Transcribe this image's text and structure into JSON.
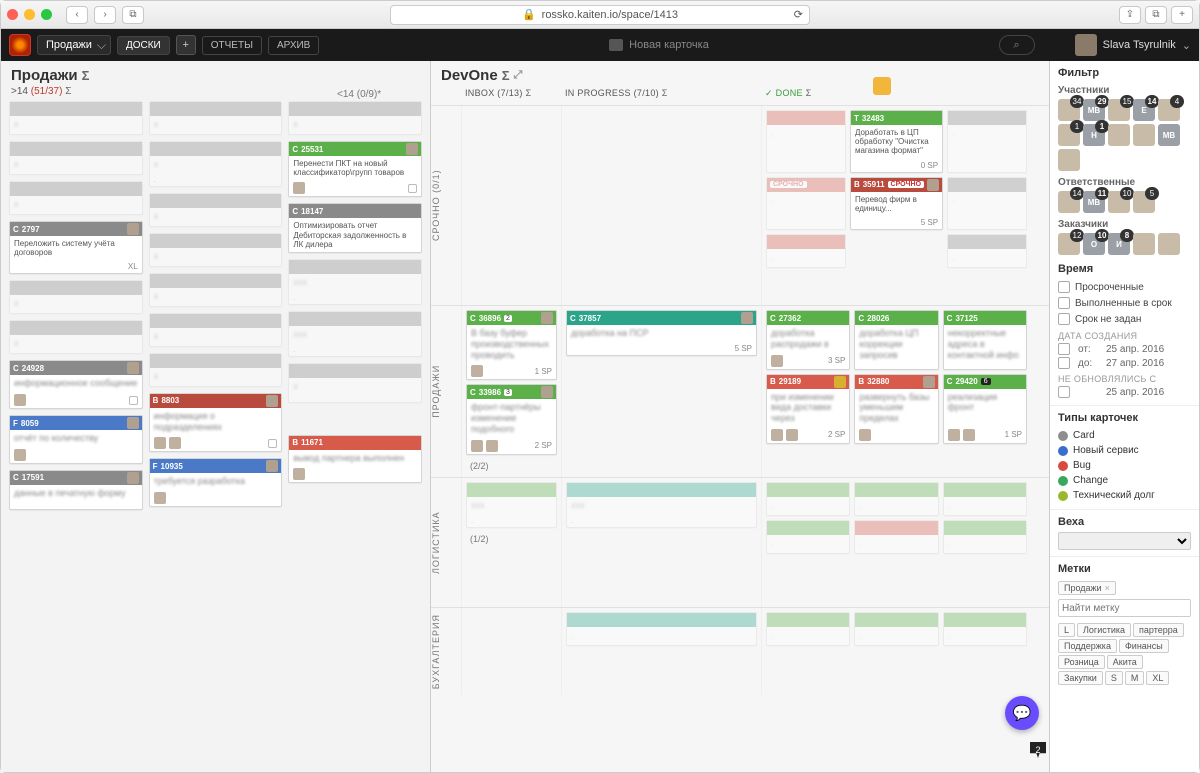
{
  "browser": {
    "url": "rossko.kaiten.io/space/1413"
  },
  "appbar": {
    "space": "Продажи",
    "boards_btn": "ДОСКИ",
    "reports_btn": "ОТЧЕТЫ",
    "archive_btn": "АРХИВ",
    "center": "Новая карточка",
    "user": "Slava Tsyrulnik"
  },
  "left_board": {
    "title": "Продажи",
    "wip": ">14",
    "wipcount": "(51/37)",
    "overflow": "<14 (0/9)*",
    "cards": {
      "c25531": {
        "letter": "C",
        "num": "25531",
        "body": "Перенести ПКТ на новый классификатор\\групп товаров"
      },
      "c18147": {
        "letter": "C",
        "num": "18147",
        "body": "Оптимизировать отчет Дебиторская задолженность в ЛК дилера"
      },
      "c2797": {
        "letter": "C",
        "num": "2797",
        "body": "Переложить систему учёта договоров",
        "size": "XL"
      },
      "c24928": {
        "letter": "C",
        "num": "24928"
      },
      "b8803": {
        "letter": "B",
        "num": "8803"
      },
      "f8059": {
        "letter": "F",
        "num": "8059"
      },
      "f10935": {
        "letter": "F",
        "num": "10935"
      },
      "b11671": {
        "letter": "B",
        "num": "11671"
      },
      "c17591": {
        "letter": "C",
        "num": "17591"
      }
    }
  },
  "right_board": {
    "title": "DevOne",
    "cols": {
      "inbox": "INBOX (7/13)",
      "inprog": "IN PROGRESS (7/10)",
      "done": "DONE"
    },
    "lanes": {
      "srochno": "СРОЧНО (0/1)",
      "prodazhi": "ПРОДАЖИ",
      "logistika": "ЛОГИСТИКА",
      "bukh": "БУХГАЛТЕРИЯ"
    },
    "cards": {
      "t32483": {
        "letter": "T",
        "num": "32483",
        "sp": "0 SP",
        "body": "Доработать в ЦП обработку \"Очистка магазина формат\""
      },
      "b35911": {
        "letter": "B",
        "num": "35911",
        "sp": "5 SP",
        "badge": "СРОЧНО",
        "body": "Перевод фирм в единицу..."
      },
      "c36896": {
        "letter": "C",
        "num": "36896",
        "ind": "2",
        "sp": "1 SP"
      },
      "c33986": {
        "letter": "C",
        "num": "33986",
        "ind": "3",
        "sp": "2 SP"
      },
      "c37857": {
        "letter": "C",
        "num": "37857",
        "sp": "5 SP"
      },
      "c27362": {
        "letter": "C",
        "num": "27362",
        "sp": "3 SP"
      },
      "c28026": {
        "letter": "C",
        "num": "28026"
      },
      "c37125": {
        "letter": "C",
        "num": "37125"
      },
      "b29189": {
        "letter": "B",
        "num": "29189",
        "sp": "2 SP"
      },
      "b32880": {
        "letter": "B",
        "num": "32880"
      },
      "c29420": {
        "letter": "C",
        "num": "29420",
        "ind": "6",
        "sp": "1 SP"
      }
    },
    "lane_counts": {
      "prodazhi": "(2/2)",
      "logistika": "(1/2)"
    },
    "pointer": "2"
  },
  "filter": {
    "title": "Фильтр",
    "members_h": "Участники",
    "responsible_h": "Ответственные",
    "customers_h": "Заказчики",
    "members": [
      {
        "c": "34"
      },
      {
        "c": "29",
        "txt": "МВ"
      },
      {
        "c": "15"
      },
      {
        "c": "14",
        "txt": "Е"
      },
      {
        "c": "4"
      },
      {
        "c": "1"
      },
      {
        "c": "1",
        "txt": "Н"
      },
      {
        "c": ""
      },
      {
        "c": ""
      },
      {
        "c": "",
        "txt": "МВ"
      },
      {
        "c": ""
      }
    ],
    "responsible": [
      {
        "c": "14"
      },
      {
        "c": "11",
        "txt": "МВ"
      },
      {
        "c": "10"
      },
      {
        "c": "5"
      }
    ],
    "customers": [
      {
        "c": "12"
      },
      {
        "c": "10",
        "txt": "О"
      },
      {
        "c": "8",
        "txt": "И"
      },
      {
        "c": ""
      },
      {
        "c": ""
      }
    ],
    "time_h": "Время",
    "time1": "Просроченные",
    "time2": "Выполненные в срок",
    "time3": "Срок не задан",
    "created_h": "ДАТА СОЗДАНИЯ",
    "from": "от:",
    "to": "до:",
    "datefrom": "25 апр. 2016",
    "dateto": "27 апр. 2016",
    "notupd_h": "НЕ ОБНОВЛЯЛИСЬ С",
    "dateupd": "25 апр. 2016",
    "types_h": "Типы карточек",
    "types": [
      {
        "c": "#8e8e8e",
        "t": "Card"
      },
      {
        "c": "#3a6dd0",
        "t": "Новый сервис"
      },
      {
        "c": "#d84a3e",
        "t": "Bug"
      },
      {
        "c": "#3aa85a",
        "t": "Change"
      },
      {
        "c": "#9ab82c",
        "t": "Технический долг"
      }
    ],
    "milestone_h": "Веха",
    "labels_h": "Метки",
    "findlabel_ph": "Найти метку",
    "selected_tag": "Продажи",
    "tags": [
      "L",
      "Логистика",
      "партерра",
      "Поддержка",
      "Финансы",
      "Розница",
      "Акита",
      "Закупки",
      "S",
      "M",
      "XL"
    ]
  }
}
